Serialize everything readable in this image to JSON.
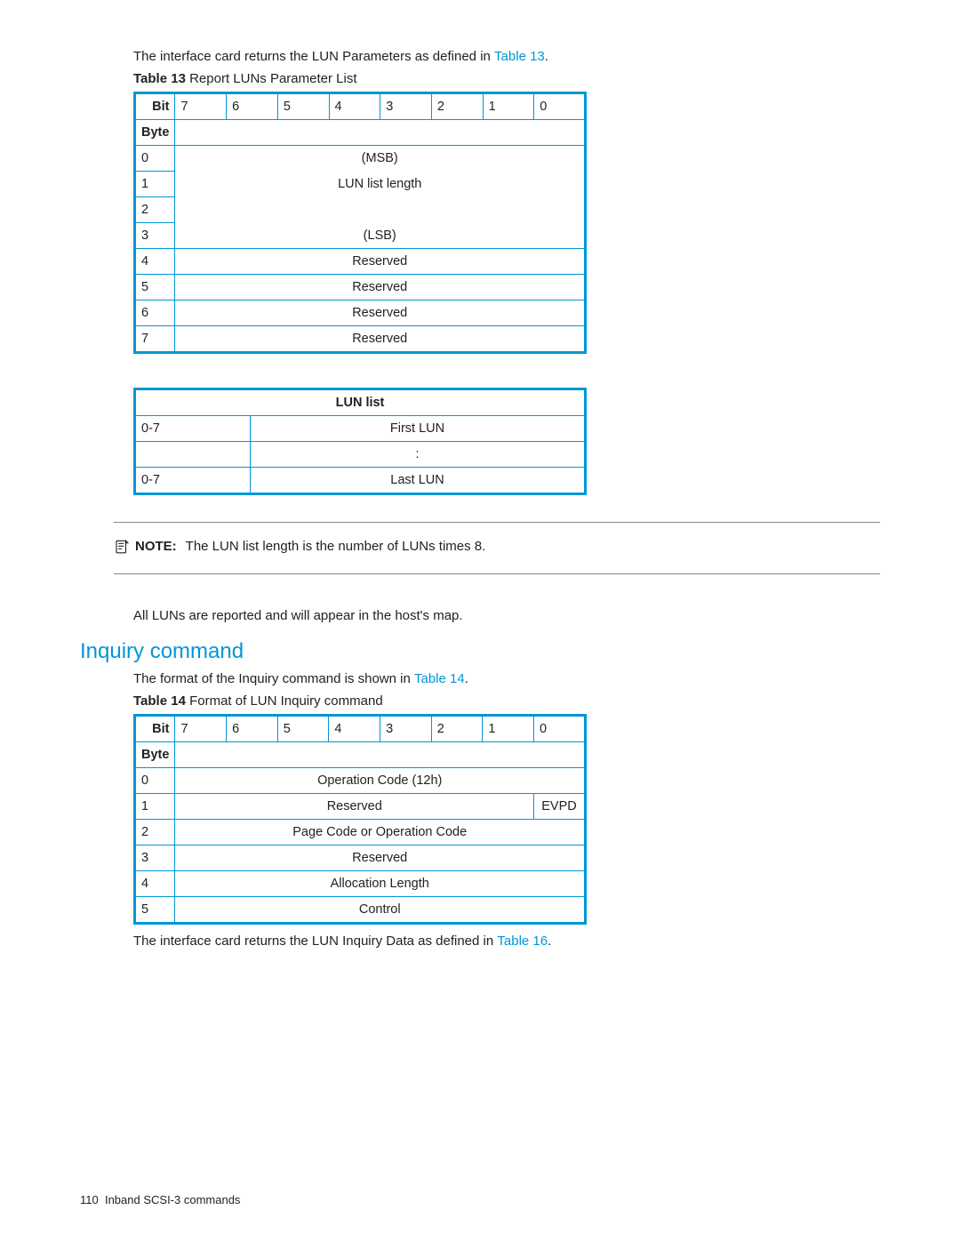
{
  "intro_text_1a": "The interface card returns the LUN Parameters as defined in ",
  "intro_text_1b": "Table 13",
  "intro_text_1c": ".",
  "table13_caption_label": "Table 13",
  "table13_caption_text": "   Report LUNs Parameter List",
  "bit_label": "Bit",
  "byte_label": "Byte",
  "bits": [
    "7",
    "6",
    "5",
    "4",
    "3",
    "2",
    "1",
    "0"
  ],
  "t13_rows": {
    "r0_byte": "0",
    "r0_val": "(MSB)",
    "r1_byte": "1",
    "r1_val": "LUN list length",
    "r2_byte": "2",
    "r3_byte": "3",
    "r3_val": "(LSB)",
    "r4_byte": "4",
    "r4_val": "Reserved",
    "r5_byte": "5",
    "r5_val": "Reserved",
    "r6_byte": "6",
    "r6_val": "Reserved",
    "r7_byte": "7",
    "r7_val": "Reserved"
  },
  "lun_list_header": "LUN list",
  "lun_list": {
    "r0_left": "0-7",
    "r0_val": "First LUN",
    "r1_val": ":",
    "r2_left": "0-7",
    "r2_val": "Last LUN"
  },
  "note_label": "NOTE:",
  "note_text": "The LUN list length is the number of LUNs times 8.",
  "all_luns_text": "All LUNs are reported and will appear in the host's map.",
  "section_heading": "Inquiry command",
  "inquiry_intro_a": "The format of the Inquiry command is shown in ",
  "inquiry_intro_b": "Table 14",
  "inquiry_intro_c": ".",
  "table14_caption_label": "Table 14",
  "table14_caption_text": "   Format of LUN Inquiry command",
  "t14_rows": {
    "r0_byte": "0",
    "r0_val": "Operation Code (12h)",
    "r1_byte": "1",
    "r1_left": "Reserved",
    "r1_right": "EVPD",
    "r2_byte": "2",
    "r2_val": "Page Code or Operation Code",
    "r3_byte": "3",
    "r3_val": "Reserved",
    "r4_byte": "4",
    "r4_val": "Allocation Length",
    "r5_byte": "5",
    "r5_val": "Control"
  },
  "outro_a": "The interface card returns the LUN Inquiry Data as defined in ",
  "outro_b": "Table 16",
  "outro_c": ".",
  "footer_page": "110",
  "footer_text": "Inband SCSI-3 commands"
}
